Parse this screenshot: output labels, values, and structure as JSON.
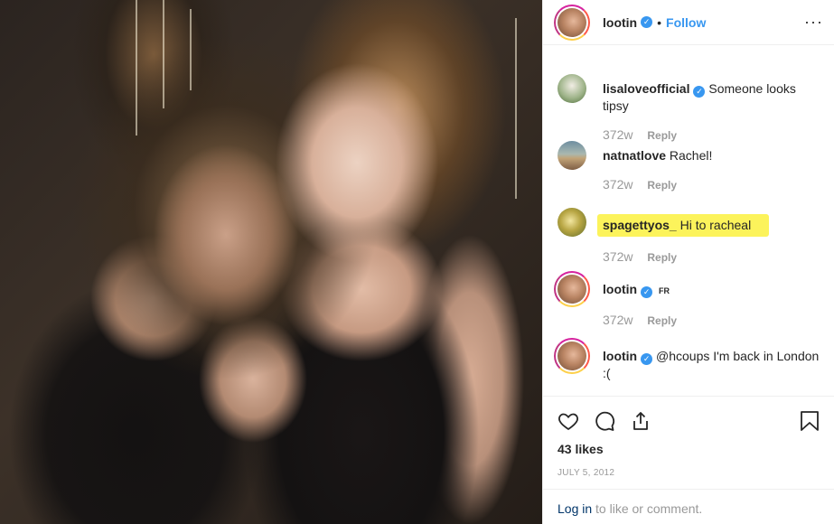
{
  "header": {
    "username": "lootin",
    "verified_icon": "verified-badge-icon",
    "separator": "•",
    "follow_label": "Follow",
    "more_label": "···"
  },
  "comments": [
    {
      "username": "lisaloveofficial",
      "verified": true,
      "text": "Someone looks tipsy",
      "age": "372w",
      "reply_label": "Reply"
    },
    {
      "username": "natnatlove",
      "verified": false,
      "text": "Rachel!",
      "age": "372w",
      "reply_label": "Reply"
    },
    {
      "username": "spagettyos_",
      "verified": false,
      "text": "Hi to racheal",
      "age": "372w",
      "reply_label": "Reply",
      "highlight_color": "#fcf35b"
    },
    {
      "username": "lootin",
      "verified": true,
      "text": "FR",
      "age": "372w",
      "reply_label": "Reply"
    },
    {
      "username": "lootin",
      "verified": true,
      "text": "@hcoups I'm back in London",
      "text_line2": ":("
    }
  ],
  "actions": {
    "like_icon": "heart-icon",
    "comment_icon": "comment-icon",
    "share_icon": "share-icon",
    "save_icon": "bookmark-icon",
    "likes": "43 likes",
    "date": "JULY 5, 2012"
  },
  "footer": {
    "login_link": "Log in",
    "login_text": " to like or comment."
  },
  "colors": {
    "accent": "#3897f0",
    "highlight": "#fcf35b",
    "muted": "#999999",
    "text": "#262626"
  }
}
